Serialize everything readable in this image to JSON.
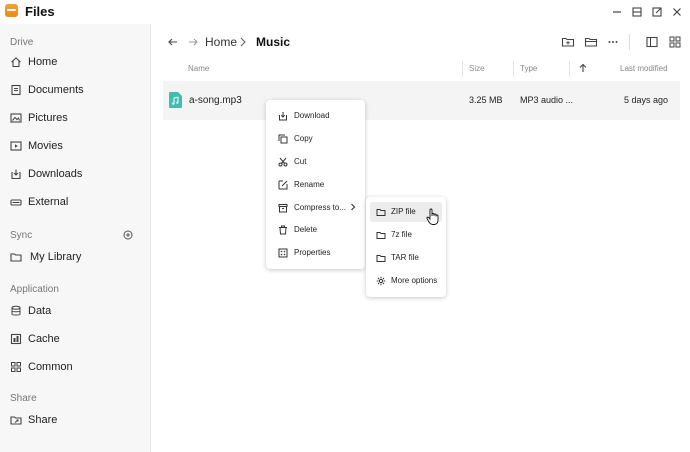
{
  "app": {
    "title": "Files",
    "accent": "#f0a030"
  },
  "window_controls": [
    "minimize-icon",
    "restore-icon",
    "expand-icon",
    "close-icon"
  ],
  "sidebar": {
    "sections": [
      {
        "label": "Drive",
        "items": [
          {
            "label": "Home",
            "icon": "home-icon"
          },
          {
            "label": "Documents",
            "icon": "document-icon"
          },
          {
            "label": "Pictures",
            "icon": "picture-icon"
          },
          {
            "label": "Movies",
            "icon": "movie-icon"
          },
          {
            "label": "Downloads",
            "icon": "download-icon"
          },
          {
            "label": "External",
            "icon": "drive-icon"
          }
        ]
      },
      {
        "label": "Sync",
        "items": [
          {
            "label": "My Library",
            "icon": "folder-icon"
          }
        ]
      },
      {
        "label": "Application",
        "items": [
          {
            "label": "Data",
            "icon": "database-icon"
          },
          {
            "label": "Cache",
            "icon": "cache-icon"
          },
          {
            "label": "Common",
            "icon": "grid-icon"
          }
        ]
      },
      {
        "label": "Share",
        "items": [
          {
            "label": "Share",
            "icon": "shared-folder-icon"
          }
        ]
      }
    ]
  },
  "toolbar": {
    "breadcrumb": [
      "Home",
      "Music"
    ]
  },
  "table": {
    "columns": [
      "Name",
      "Size",
      "Type",
      "Last modified"
    ],
    "rows": [
      {
        "name": "a-song.mp3",
        "size": "3.25 MB",
        "type": "MP3 audio ...",
        "modified": "5 days ago",
        "icon": "music-file-icon"
      }
    ]
  },
  "context_menu": {
    "items": [
      {
        "label": "Download",
        "icon": "download-icon"
      },
      {
        "label": "Copy",
        "icon": "copy-icon"
      },
      {
        "label": "Cut",
        "icon": "cut-icon"
      },
      {
        "label": "Rename",
        "icon": "rename-icon"
      },
      {
        "label": "Compress to...",
        "icon": "archive-icon"
      },
      {
        "label": "Delete",
        "icon": "trash-icon"
      },
      {
        "label": "Properties",
        "icon": "properties-icon"
      }
    ]
  },
  "submenu": {
    "items": [
      {
        "label": "ZIP file",
        "icon": "zip-folder-icon"
      },
      {
        "label": "7z file",
        "icon": "7z-folder-icon"
      },
      {
        "label": "TAR file",
        "icon": "tar-folder-icon"
      },
      {
        "label": "More options",
        "icon": "settings-icon"
      }
    ]
  }
}
